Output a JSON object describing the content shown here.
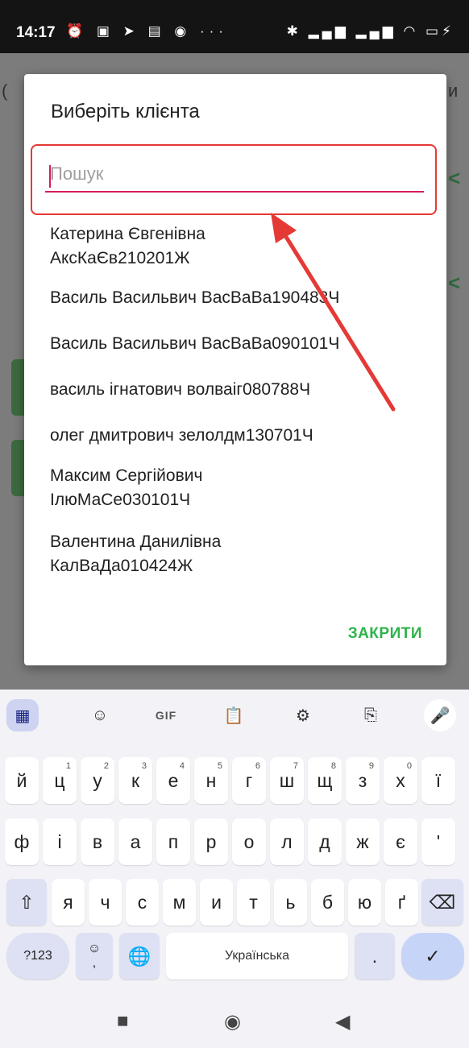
{
  "status_bar": {
    "time": "14:17",
    "left_icons": "⏰ ▣ ➤ ▤ ◉ ···",
    "right_icons": "✱ ▂▄▆ ▂▄▆ ◠ ▭⚡"
  },
  "dialog": {
    "title": "Виберіть клієнта",
    "search_placeholder": "Пошук",
    "search_value": "",
    "clients": [
      {
        "line1": "Катерина Євгенівна",
        "line2": "АксКаЄв210201Ж"
      },
      {
        "line1": "Василь Васильвич ВасВаВа190483Ч",
        "line2": ""
      },
      {
        "line1": "Василь Васильвич ВасВаВа090101Ч",
        "line2": ""
      },
      {
        "line1": "василь ігнатович волваіг080788Ч",
        "line2": ""
      },
      {
        "line1": "олег дмитрович зелолдм130701Ч",
        "line2": ""
      },
      {
        "line1": "Максим Сергійович",
        "line2": "ІлюМаСе030101Ч"
      },
      {
        "line1": "Валентина Данилівна",
        "line2": "КалВаДа010424Ж"
      }
    ],
    "close_label": "ЗАКРИТИ"
  },
  "keyboard": {
    "toolbar": {
      "gif_label": "GIF"
    },
    "row1": [
      "й",
      "ц",
      "у",
      "к",
      "е",
      "н",
      "г",
      "ш",
      "щ",
      "з",
      "х",
      "ї"
    ],
    "row1_sup": [
      "",
      "1",
      "2",
      "3",
      "4",
      "5",
      "6",
      "7",
      "8",
      "9",
      "0",
      ""
    ],
    "row2": [
      "ф",
      "і",
      "в",
      "а",
      "п",
      "р",
      "о",
      "л",
      "д",
      "ж",
      "є",
      "'"
    ],
    "row3": [
      "я",
      "ч",
      "с",
      "м",
      "и",
      "т",
      "ь",
      "б",
      "ю",
      "ґ"
    ],
    "symbols_label": "?123",
    "space_label": "Українська",
    "period_label": ".",
    "comma_label": ","
  },
  "colors": {
    "accent_pink": "#d81b60",
    "highlight_red": "#e53935",
    "close_green": "#2db34a"
  }
}
